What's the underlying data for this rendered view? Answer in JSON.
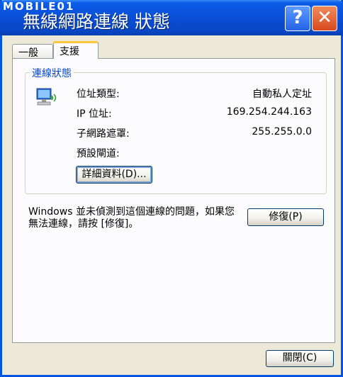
{
  "window": {
    "brand": "MOBILE01",
    "title": "無線網路連線 狀態",
    "help_glyph": "?",
    "close_glyph": "✕"
  },
  "tabs": [
    {
      "label": "一般",
      "active": false
    },
    {
      "label": "支援",
      "active": true
    }
  ],
  "connection_status": {
    "group_label": "連線狀態",
    "rows": [
      {
        "label": "位址類型:",
        "value": "自動私人定址"
      },
      {
        "label": "IP 位址:",
        "value": "169.254.244.163"
      },
      {
        "label": "子網路遮罩:",
        "value": "255.255.0.0"
      },
      {
        "label": "預設閘道:",
        "value": ""
      }
    ],
    "details_button": "詳細資料(D)..."
  },
  "repair": {
    "message": "Windows 並未偵測到這個連線的問題，如果您無法連線，請按 [修復]。",
    "button": "修復(P)"
  },
  "footer": {
    "close_button": "關閉(C)"
  }
}
